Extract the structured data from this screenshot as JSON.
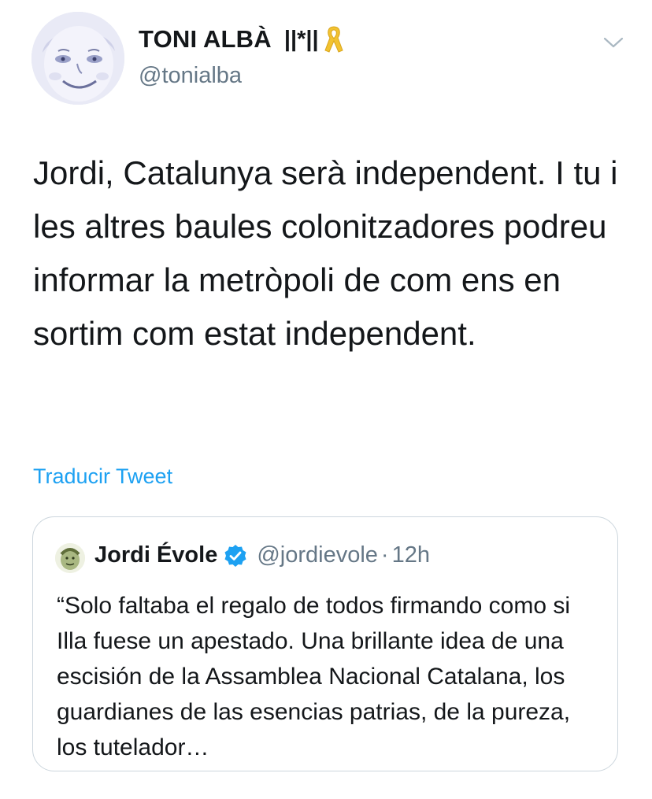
{
  "author": {
    "display_name": "TONI ALBÀ",
    "name_symbols": "||*||",
    "handle": "@tonialba",
    "ribbon_icon": "yellow-ribbon-icon",
    "ribbon_color": "#f5c518"
  },
  "tweet": {
    "text": "Jordi, Catalunya serà independent. I tu i les altres baules colonitzadores podreu informar la metròpoli de com ens en sortim com estat independent.",
    "translate_label": "Traducir Tweet"
  },
  "quoted_tweet": {
    "display_name": "Jordi Évole",
    "verified": true,
    "handle": "@jordievole",
    "separator": "·",
    "time": "12h",
    "text": "“Solo faltaba el regalo de todos firmando como si Illa fuese un apestado. Una brillante idea de una escisión de la Assamblea Nacional Catalana, los guardianes de las esencias patrias, de la pureza, los tutelador…"
  },
  "colors": {
    "link": "#1da1f2",
    "secondary_text": "#657786",
    "border": "#ccd6dd",
    "verified": "#1da1f2"
  }
}
